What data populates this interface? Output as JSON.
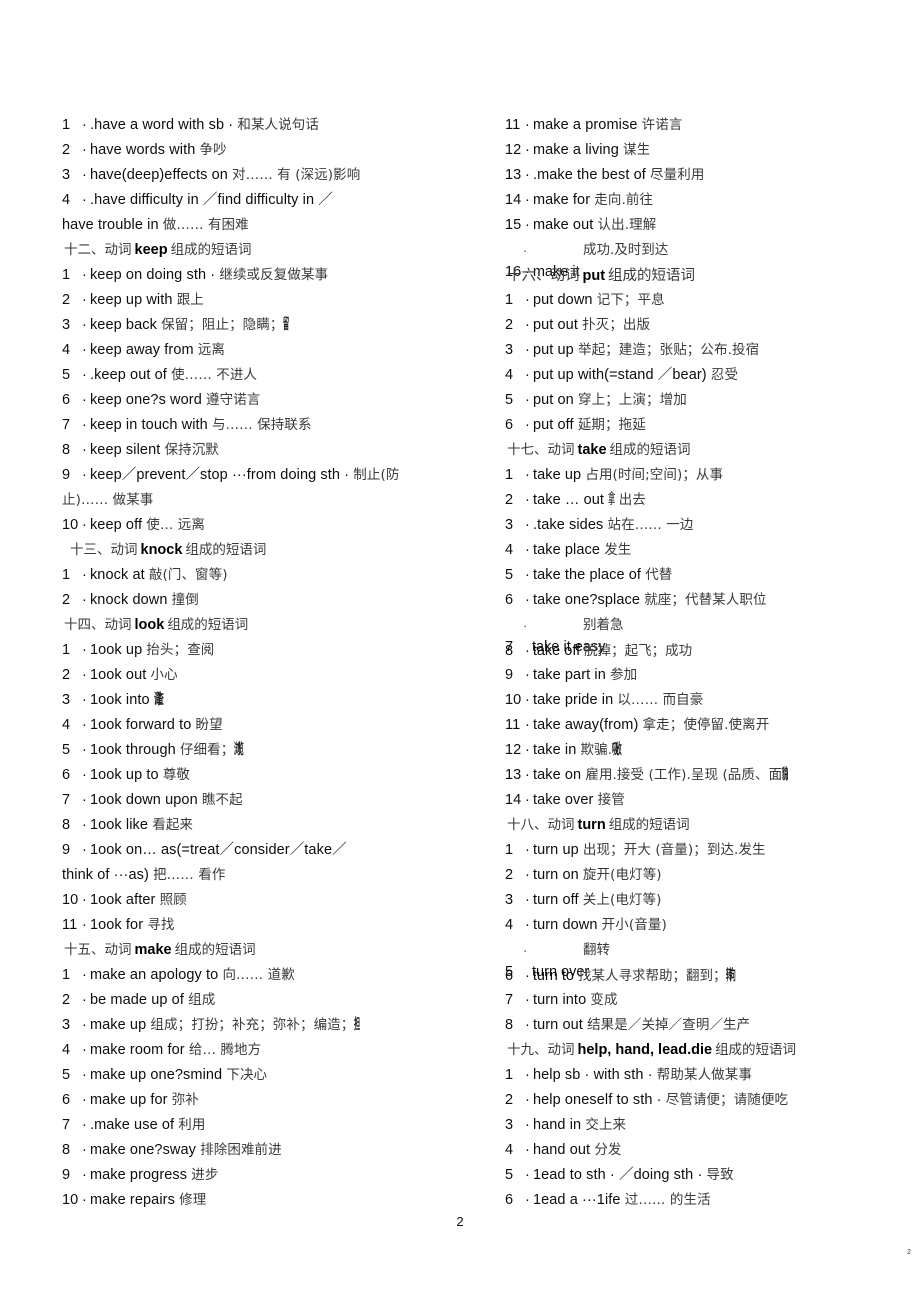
{
  "document": {
    "page_number": "2",
    "corner_mark": "2"
  },
  "left_column": [
    {
      "kind": "entry",
      "num": "1",
      "en": ".have a word with sb",
      "sep": "·",
      "cn": "和某人说句话"
    },
    {
      "kind": "entry",
      "num": "2",
      "en": "have words with",
      "cn": "争吵"
    },
    {
      "kind": "entry",
      "num": "3",
      "en": "have(deep)effects on",
      "cn": "对…… 有 (深远)影响"
    },
    {
      "kind": "entry",
      "num": "4",
      "en": ".have difficulty in ／find difficulty in ／",
      "cn": ""
    },
    {
      "kind": "cont",
      "en": "have trouble in",
      "cn": "做…… 有困难"
    },
    {
      "kind": "section",
      "prefix": "十二、动词",
      "verb": "keep",
      "suffix": "组成的短语词"
    },
    {
      "kind": "entry",
      "num": "1",
      "en": "keep on doing sth",
      "sep": "·",
      "cn": "继续或反复做某事"
    },
    {
      "kind": "entry",
      "num": "2",
      "en": "keep up with",
      "cn": "跟上"
    },
    {
      "kind": "entry",
      "num": "3",
      "en": "keep back",
      "cn": "保留；阻止；隐瞒；",
      "squeeze": "留"
    },
    {
      "kind": "entry",
      "num": "4",
      "en": "keep away from",
      "cn": "远离"
    },
    {
      "kind": "entry",
      "num": "5",
      "en": ".keep out of",
      "cn": "使…… 不进人"
    },
    {
      "kind": "entry",
      "num": "6",
      "en": "keep one?s word",
      "cn": "遵守诺言"
    },
    {
      "kind": "entry",
      "num": "7",
      "en": "keep in touch with",
      "cn": "与…… 保持联系"
    },
    {
      "kind": "entry",
      "num": "8",
      "en": "keep silent",
      "cn": "保持沉默"
    },
    {
      "kind": "entry",
      "num": "9",
      "en": "keep／prevent／stop ···from doing sth",
      "sep": "·",
      "cn": "制止(防"
    },
    {
      "kind": "cont",
      "en": "",
      "cn": "止)…… 做某事"
    },
    {
      "kind": "entry",
      "num": "10",
      "en": "keep off",
      "cn": "使… 远离"
    },
    {
      "kind": "section",
      "indent": true,
      "prefix": "十三、动词",
      "verb": "knock",
      "suffix": "组成的短语词"
    },
    {
      "kind": "entry",
      "num": "1",
      "en": "knock at",
      "cn": "敲(门、窗等)"
    },
    {
      "kind": "entry",
      "num": "2",
      "en": "knock down",
      "cn": "撞倒"
    },
    {
      "kind": "section",
      "prefix": "十四、动词",
      "verb": "look",
      "suffix": "组成的短语词"
    },
    {
      "kind": "entry",
      "num": "1",
      "en": "1ook up",
      "cn": "抬头；查阅"
    },
    {
      "kind": "entry",
      "num": "2",
      "en": "1ook out",
      "cn": "小心"
    },
    {
      "kind": "entry",
      "num": "3",
      "en": "1ook into",
      "cn": "",
      "squeeze": "调查"
    },
    {
      "kind": "entry",
      "num": "4",
      "en": "1ook forward to",
      "cn": "盼望"
    },
    {
      "kind": "entry",
      "num": "5",
      "en": "1ook through",
      "cn": "仔细看；",
      "squeeze": "浏览"
    },
    {
      "kind": "entry",
      "num": "6",
      "en": "1ook up to",
      "cn": "尊敬"
    },
    {
      "kind": "entry",
      "num": "7",
      "en": "1ook down upon",
      "cn": "瞧不起"
    },
    {
      "kind": "entry",
      "num": "8",
      "en": "1ook like",
      "cn": "看起来"
    },
    {
      "kind": "entry",
      "num": "9",
      "en": "1ook on… as(=treat／consider／take／",
      "cn": ""
    },
    {
      "kind": "cont",
      "en": "think of ···as)",
      "cn": "把…… 看作"
    },
    {
      "kind": "entry",
      "num": "10",
      "en": "1ook after",
      "cn": "照顾"
    },
    {
      "kind": "entry",
      "num": "11",
      "en": "1ook for",
      "cn": "寻找"
    },
    {
      "kind": "section",
      "prefix": "十五、动词",
      "verb": "make",
      "suffix": "组成的短语词"
    },
    {
      "kind": "entry",
      "num": "1",
      "en": "make an apology to",
      "cn": "向…… 道歉"
    },
    {
      "kind": "entry",
      "num": "2",
      "en": "be made up of",
      "cn": "组成"
    },
    {
      "kind": "entry",
      "num": "3",
      "en": "make up",
      "cn": "组成；打扮；补充；弥补；编造；",
      "squeeze": "担"
    },
    {
      "kind": "entry",
      "num": "4",
      "en": "make room for",
      "cn": "给… 腾地方"
    },
    {
      "kind": "entry",
      "num": "5",
      "en": "make up one?smind",
      "cn": "下决心"
    },
    {
      "kind": "entry",
      "num": "6",
      "en": "make up for",
      "cn": "弥补"
    },
    {
      "kind": "entry",
      "num": "7",
      "en": ".make use of",
      "cn": "利用"
    },
    {
      "kind": "entry",
      "num": "8",
      "en": "make one?sway",
      "cn": "排除困难前进"
    },
    {
      "kind": "entry",
      "num": "9",
      "en": "make progress",
      "cn": "进步"
    },
    {
      "kind": "entry",
      "num": "10",
      "en": "make repairs",
      "cn": "修理"
    }
  ],
  "right_column": [
    {
      "kind": "entry",
      "num": "11",
      "en": "make a promise",
      "cn": "许诺言"
    },
    {
      "kind": "entry",
      "num": "12",
      "en": "make a living",
      "cn": "谋生"
    },
    {
      "kind": "entry",
      "num": "13",
      "en": ".make the best of",
      "cn": "尽量利用"
    },
    {
      "kind": "entry",
      "num": "14",
      "en": "make for",
      "cn": "走向.前往"
    },
    {
      "kind": "entry",
      "num": "15",
      "en": "make out",
      "cn": "认出.理解"
    },
    {
      "kind": "overlap",
      "stray": "·",
      "gloss": "成功.及时到达",
      "layer_a": {
        "num": "16",
        "en": "make it"
      },
      "layer_b": {
        "section": true,
        "prefix": "十六、动词",
        "verb": "put",
        "suffix": "组成的短语词"
      }
    },
    {
      "kind": "entry",
      "num": "1",
      "en": "put down",
      "cn": "记下；平息"
    },
    {
      "kind": "entry",
      "num": "2",
      "en": "put out",
      "cn": "扑灭；出版"
    },
    {
      "kind": "entry",
      "num": "3",
      "en": "put up",
      "cn": "举起；建造；张贴；公布.投宿"
    },
    {
      "kind": "entry",
      "num": "4",
      "en": "put up with(=stand ／bear)",
      "cn": "忍受"
    },
    {
      "kind": "entry",
      "num": "5",
      "en": "put on",
      "cn": "穿上；上演；增加"
    },
    {
      "kind": "entry",
      "num": "6",
      "en": "put off",
      "cn": "延期；拖延"
    },
    {
      "kind": "section",
      "prefix": "十七、动词",
      "verb": "take",
      "suffix": "组成的短语词"
    },
    {
      "kind": "entry",
      "num": "1",
      "en": "take up",
      "cn": "占用(时间;空间)；从事"
    },
    {
      "kind": "entry",
      "num": "2",
      "en": "take … out",
      "cn": "",
      "squeeze_l": "拿",
      "cn_after": "出去"
    },
    {
      "kind": "entry",
      "num": "3",
      "en": ".take sides",
      "cn": "站在…… 一边"
    },
    {
      "kind": "entry",
      "num": "4",
      "en": "take place",
      "cn": "发生"
    },
    {
      "kind": "entry",
      "num": "5",
      "en": "take the place of",
      "cn": "代替"
    },
    {
      "kind": "entry",
      "num": "6",
      "en": "take one?splace",
      "cn": "就座；代替某人职位"
    },
    {
      "kind": "overlap",
      "stray": "·",
      "gloss": "别着急",
      "layer_a": {
        "num": "7",
        "en": "take it easy",
        "no_dot": true
      },
      "layer_b": {
        "num": "8",
        "en": "take off",
        "cn": "脱掉；起飞；成功"
      }
    },
    {
      "kind": "entry",
      "num": "9",
      "en": "take part in",
      "cn": "参加"
    },
    {
      "kind": "entry",
      "num": "10",
      "en": "take pride in",
      "cn": "以…… 而自豪"
    },
    {
      "kind": "entry",
      "num": "11",
      "en": "take away(from)",
      "cn": "拿走；使停留.使离开"
    },
    {
      "kind": "entry",
      "num": "12",
      "en": "take in",
      "cn": "欺骗.",
      "squeeze": "吸收"
    },
    {
      "kind": "entry",
      "num": "13",
      "en": "take on",
      "cn": "雇用.接受 (工作).呈现 (品质、面",
      "squeeze": "貌)"
    },
    {
      "kind": "entry",
      "num": "14",
      "en": "take over",
      "cn": "接管"
    },
    {
      "kind": "section",
      "prefix": "十八、动词",
      "verb": "turn",
      "suffix": "组成的短语词"
    },
    {
      "kind": "entry",
      "num": "1",
      "en": "turn up",
      "cn": "出现；开大 (音量)；到达.发生"
    },
    {
      "kind": "entry",
      "num": "2",
      "en": "turn on",
      "cn": "旋开(电灯等)"
    },
    {
      "kind": "entry",
      "num": "3",
      "en": "turn off",
      "cn": "关上(电灯等)"
    },
    {
      "kind": "entry",
      "num": "4",
      "en": "turn down",
      "cn": "开小(音量)"
    },
    {
      "kind": "overlap",
      "stray": "·",
      "gloss": "翻转",
      "layer_a": {
        "num": "5",
        "en": "turn over",
        "no_dot": true
      },
      "layer_b": {
        "num": "6",
        "en": "turn to",
        "cn": "找某人寻求帮助；翻到；",
        "squeeze": "转向"
      }
    },
    {
      "kind": "entry",
      "num": "7",
      "en": "turn into",
      "cn": "变成"
    },
    {
      "kind": "entry",
      "num": "8",
      "en": "turn out",
      "cn": "结果是／关掉／查明／生产"
    },
    {
      "kind": "section",
      "prefix": "十九、动词",
      "verb": "help, hand, lead.die",
      "suffix": "组成的短语词"
    },
    {
      "kind": "entry",
      "num": "1",
      "en": "help sb · with sth",
      "sep": "·",
      "cn": "帮助某人做某事"
    },
    {
      "kind": "entry",
      "num": "2",
      "en": "help oneself to sth",
      "sep": "·",
      "cn": "尽管请便；请随便吃"
    },
    {
      "kind": "entry",
      "num": "3",
      "en": "hand in",
      "cn": "交上来"
    },
    {
      "kind": "entry",
      "num": "4",
      "en": "hand out",
      "cn": "分发"
    },
    {
      "kind": "entry",
      "num": "5",
      "en": "1ead to sth · ／doing sth",
      "sep": "·",
      "cn": "导致"
    },
    {
      "kind": "entry",
      "num": "6",
      "en": "1ead a ···1ife",
      "cn": "过…… 的生活"
    }
  ]
}
